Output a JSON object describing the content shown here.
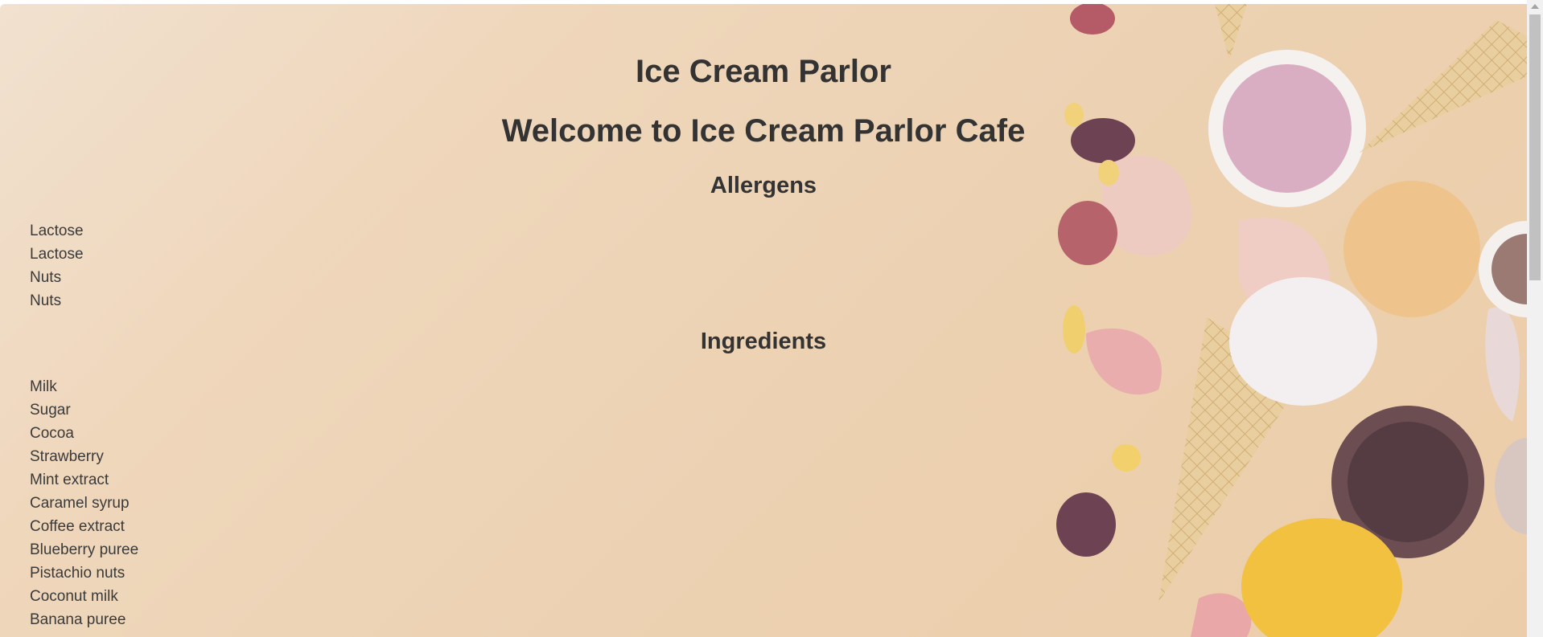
{
  "header": {
    "site_title": "Ice Cream Parlor",
    "welcome": "Welcome to Ice Cream Parlor Cafe"
  },
  "allergens": {
    "heading": "Allergens",
    "items": [
      "Lactose",
      "Lactose",
      "Nuts",
      "Nuts"
    ]
  },
  "ingredients": {
    "heading": "Ingredients",
    "items": [
      "Milk",
      "Sugar",
      "Cocoa",
      "Strawberry",
      "Mint extract",
      "Caramel syrup",
      "Coffee extract",
      "Blueberry puree",
      "Pistachio nuts",
      "Coconut milk",
      "Banana puree"
    ]
  },
  "colors": {
    "background": "#eed4b6",
    "text": "#333333"
  },
  "decor": {
    "image": "ice-cream-cones-photo"
  }
}
